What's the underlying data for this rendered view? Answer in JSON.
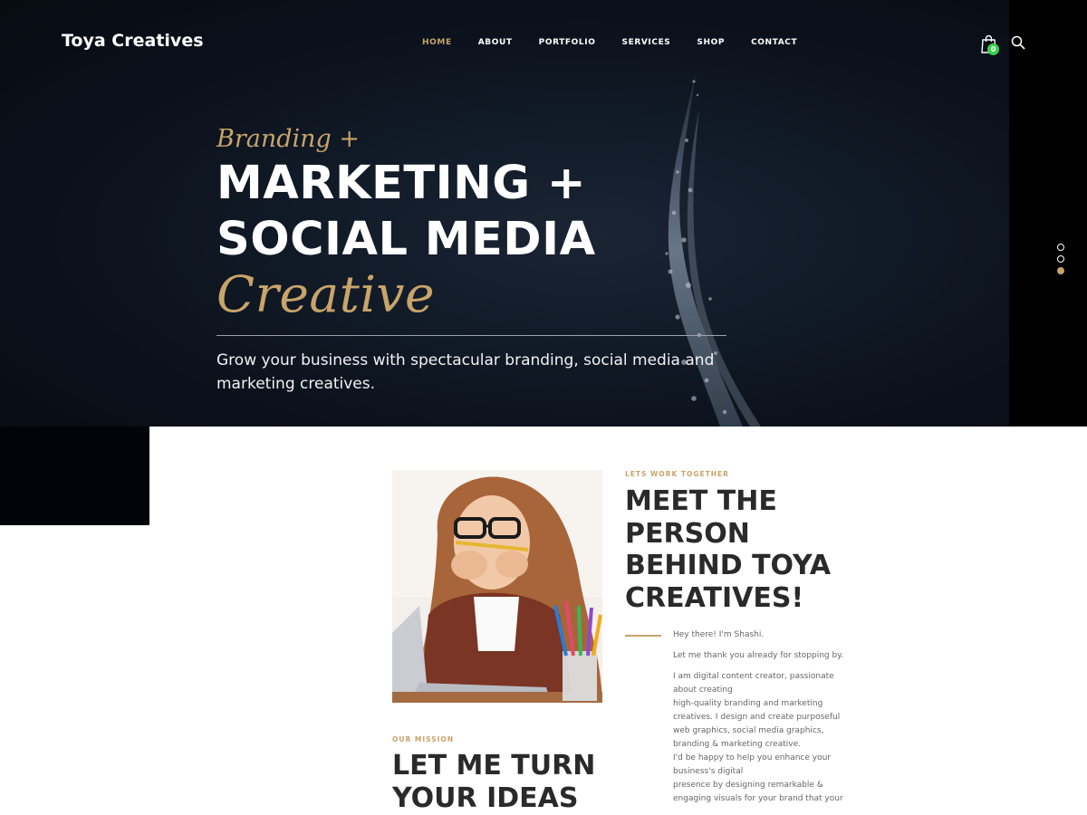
{
  "brand": {
    "name": "Toya Creatives",
    "accent": "#c7a46a"
  },
  "nav": {
    "items": [
      {
        "label": "HOME",
        "active": true
      },
      {
        "label": "ABOUT"
      },
      {
        "label": "PORTFOLIO"
      },
      {
        "label": "SERVICES"
      },
      {
        "label": "SHOP"
      },
      {
        "label": "CONTACT"
      }
    ],
    "cart_count": "0",
    "cart_icon": "shopping-bag-icon",
    "search_icon": "search-icon"
  },
  "hero": {
    "tagline": "Branding +",
    "headline_lines": [
      "MARKETING +",
      "SOCIAL MEDIA"
    ],
    "accent_word": "Creative",
    "lead": "Grow your business with spectacular branding, social media and marketing creatives.",
    "slider_dots": 3,
    "active_dot": 3
  },
  "about": {
    "eyebrow": "LETS WORK TOGETHER",
    "title_lines": [
      "MEET THE",
      "PERSON",
      "BEHIND TOYA",
      "CREATIVES!"
    ],
    "greeting": "Hey there! I'm Shashi.",
    "thanks": "Let me thank you already for stopping by.",
    "body_lines": [
      "I am digital content creator, passionate",
      "about creating",
      "high-quality branding and marketing",
      "creatives. I design and create purposeful",
      "web graphics, social media graphics,",
      "branding & marketing creative.",
      "I'd be happy to help you enhance your",
      "business's digital",
      "presence by designing remarkable &",
      "engaging visuals for your brand that your"
    ]
  },
  "mission": {
    "eyebrow": "OUR MISSION",
    "title_lines": [
      "LET ME TURN",
      "YOUR IDEAS"
    ]
  }
}
